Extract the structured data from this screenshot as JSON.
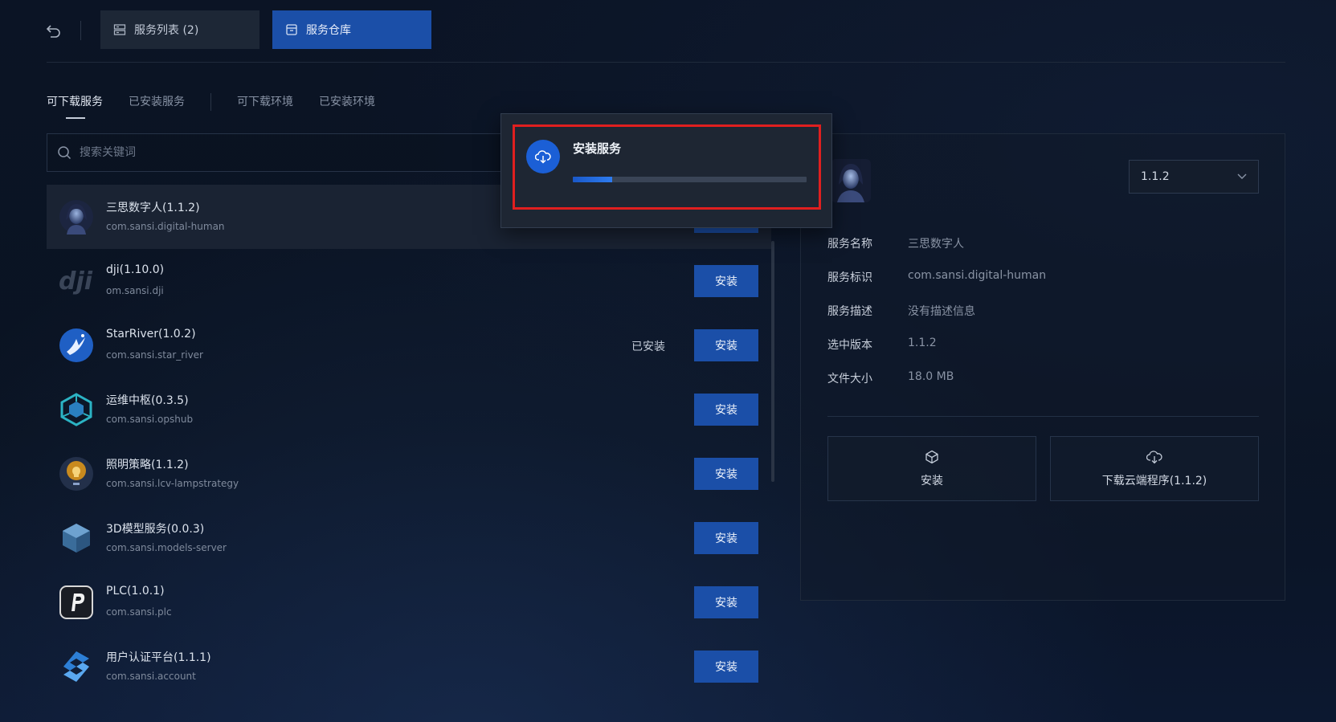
{
  "header": {
    "tabs": [
      {
        "label": "服务列表 (2)",
        "icon": "server-list-icon"
      },
      {
        "label": "服务仓库",
        "icon": "repository-icon"
      }
    ]
  },
  "sub_tabs": [
    "可下载服务",
    "已安装服务",
    "可下载环境",
    "已安装环境"
  ],
  "search": {
    "placeholder": "搜索关键词"
  },
  "services": [
    {
      "name": "三思数字人(1.1.2)",
      "pkg": "com.sansi.digital-human",
      "installed": "",
      "button": "安装",
      "icon": "digital-human-avatar"
    },
    {
      "name": "dji(1.10.0)",
      "pkg": "om.sansi.dji",
      "installed": "",
      "button": "安装",
      "icon": "dji-logo-icon"
    },
    {
      "name": "StarRiver(1.0.2)",
      "pkg": "com.sansi.star_river",
      "installed": "已安装",
      "button": "安装",
      "icon": "star-river-logo-icon"
    },
    {
      "name": "运维中枢(0.3.5)",
      "pkg": "com.sansi.opshub",
      "installed": "",
      "button": "安装",
      "icon": "opshub-cube-icon"
    },
    {
      "name": "照明策略(1.1.2)",
      "pkg": "com.sansi.lcv-lampstrategy",
      "installed": "",
      "button": "安装",
      "icon": "lamp-strategy-icon"
    },
    {
      "name": "3D模型服务(0.0.3)",
      "pkg": "com.sansi.models-server",
      "installed": "",
      "button": "安装",
      "icon": "3d-model-cube-icon"
    },
    {
      "name": "PLC(1.0.1)",
      "pkg": "com.sansi.plc",
      "installed": "",
      "button": "安装",
      "icon": "plc-logo-icon"
    },
    {
      "name": "用户认证平台(1.1.1)",
      "pkg": "com.sansi.account",
      "installed": "",
      "button": "安装",
      "icon": "account-logo-icon"
    }
  ],
  "detail": {
    "version": "1.1.2",
    "labels": {
      "name": "服务名称",
      "id": "服务标识",
      "desc": "服务描述",
      "version": "选中版本",
      "size": "文件大小"
    },
    "values": {
      "name": "三思数字人",
      "id": "com.sansi.digital-human",
      "desc": "没有描述信息",
      "version": "1.1.2",
      "size": "18.0 MB"
    },
    "actions": {
      "install": "安装",
      "download": "下载云端程序(1.1.2)"
    }
  },
  "modal": {
    "title": "安装服务",
    "progress": 0.17
  },
  "colors": {
    "accent": "#1b4fa8",
    "highlight": "#e01f1f"
  }
}
